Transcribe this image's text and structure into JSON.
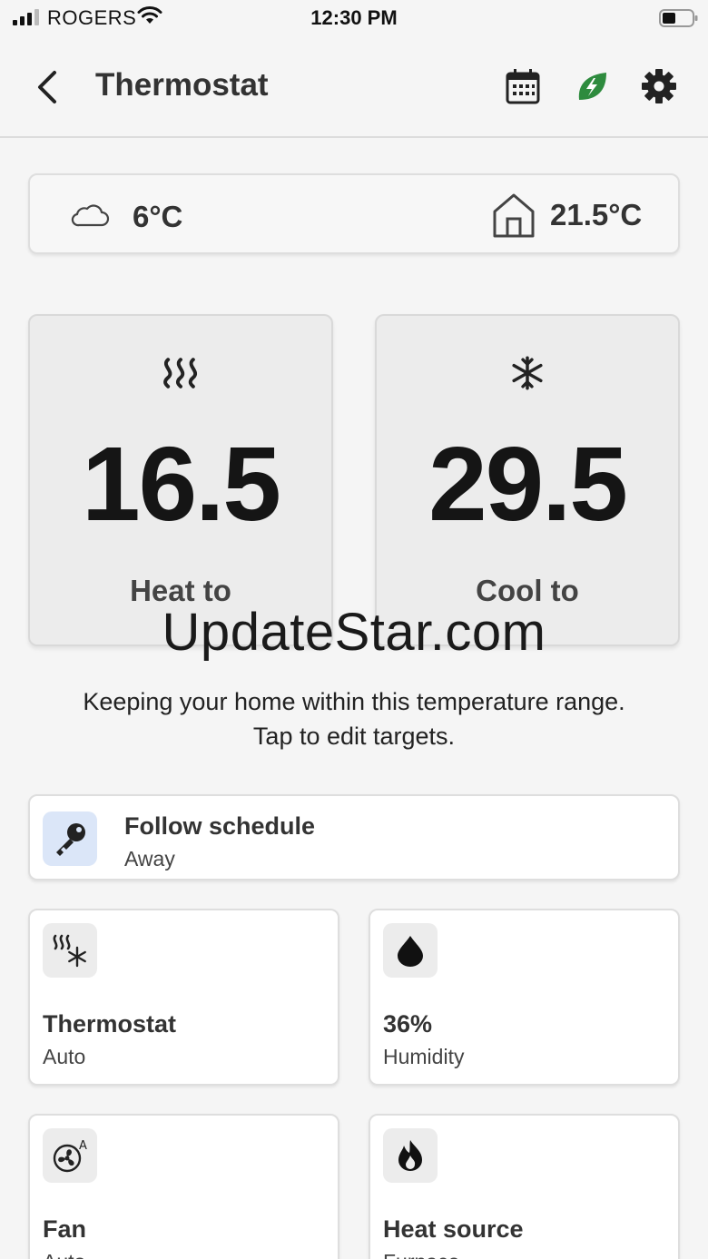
{
  "status_bar": {
    "carrier": "ROGERS",
    "time": "12:30 PM"
  },
  "header": {
    "title": "Thermostat",
    "icons": [
      "chevron-left-icon",
      "calendar-icon",
      "eco-leaf-icon",
      "gear-icon"
    ],
    "eco_color": "#2e8b3e"
  },
  "weather": {
    "outdoor_temp": "6°C",
    "indoor_temp": "21.5°C"
  },
  "setpoints": {
    "heat": {
      "value": "16.5",
      "label": "Heat to"
    },
    "cool": {
      "value": "29.5",
      "label": "Cool to"
    }
  },
  "watermark": "UpdateStar.com",
  "range_note": {
    "line1": "Keeping your home within this temperature range.",
    "line2": "Tap to edit targets."
  },
  "schedule": {
    "title": "Follow schedule",
    "subtitle": "Away",
    "icon_bg": "#dbe6f8"
  },
  "tiles": [
    {
      "title": "Thermostat",
      "subtitle": "Auto",
      "icon": "heat-cool-icon"
    },
    {
      "title": "36%",
      "subtitle": "Humidity",
      "icon": "droplet-icon"
    },
    {
      "title": "Fan",
      "subtitle": "Auto",
      "icon": "fan-auto-icon"
    },
    {
      "title": "Heat source",
      "subtitle": "Furnace",
      "icon": "flame-icon"
    }
  ]
}
